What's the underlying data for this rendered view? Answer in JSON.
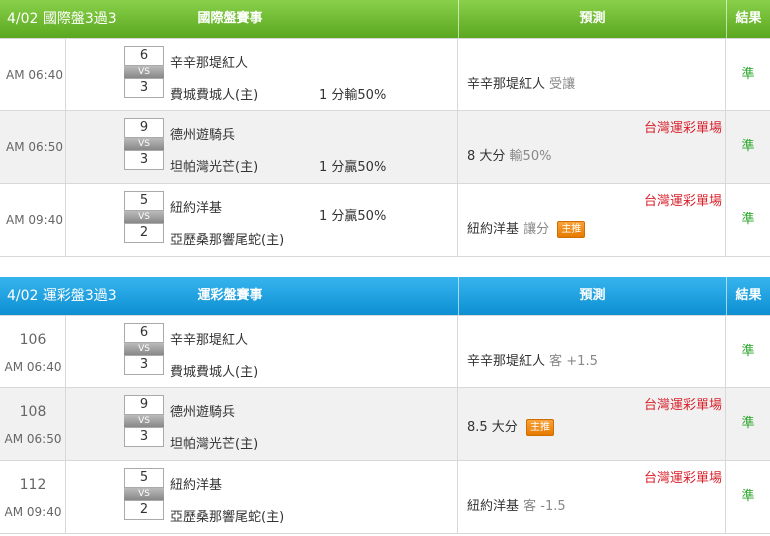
{
  "intl": {
    "header": {
      "date_label": "4/02 國際盤3過3",
      "title": "國際盤賽事",
      "prediction": "預測",
      "result": "結果"
    },
    "rows": [
      {
        "time": "AM 06:40",
        "score_top": "6",
        "vs": "VS",
        "score_bottom": "3",
        "team1": "辛辛那堤紅人",
        "team2": "費城費城人(主)",
        "handicap": "1 分輸50%",
        "single": "",
        "pick": "辛辛那堤紅人",
        "pick_note": "受讓",
        "badge": "",
        "result": "準"
      },
      {
        "time": "AM 06:50",
        "score_top": "9",
        "vs": "VS",
        "score_bottom": "3",
        "team1": "德州遊騎兵",
        "team2": "坦帕灣光芒(主)",
        "handicap": "1 分贏50%",
        "single": "台灣運彩單場",
        "pick": "8 大分",
        "pick_note": "輸50%",
        "badge": "",
        "result": "準"
      },
      {
        "time": "AM 09:40",
        "score_top": "5",
        "vs": "VS",
        "score_bottom": "2",
        "team1": "紐約洋基",
        "team2": "亞歷桑那響尾蛇(主)",
        "handicap": "1 分贏50%",
        "single": "台灣運彩單場",
        "pick": "紐約洋基",
        "pick_note": "讓分",
        "badge": "主推",
        "result": "準"
      }
    ]
  },
  "lottery": {
    "header": {
      "date_label": "4/02 運彩盤3過3",
      "title": "運彩盤賽事",
      "prediction": "預測",
      "result": "結果"
    },
    "rows": [
      {
        "number": "106",
        "time": "AM 06:40",
        "score_top": "6",
        "vs": "VS",
        "score_bottom": "3",
        "team1": "辛辛那堤紅人",
        "team2": "費城費城人(主)",
        "single": "",
        "pick": "辛辛那堤紅人",
        "pick_note": "客 +1.5",
        "badge": "",
        "result": "準"
      },
      {
        "number": "108",
        "time": "AM 06:50",
        "score_top": "9",
        "vs": "VS",
        "score_bottom": "3",
        "team1": "德州遊騎兵",
        "team2": "坦帕灣光芒(主)",
        "single": "台灣運彩單場",
        "pick": "8.5 大分",
        "pick_note": "",
        "badge": "主推",
        "result": "準"
      },
      {
        "number": "112",
        "time": "AM 09:40",
        "score_top": "5",
        "vs": "VS",
        "score_bottom": "2",
        "team1": "紐約洋基",
        "team2": "亞歷桑那響尾蛇(主)",
        "single": "台灣運彩單場",
        "pick": "紐約洋基",
        "pick_note": "客 -1.5",
        "badge": "",
        "result": "準"
      }
    ]
  }
}
